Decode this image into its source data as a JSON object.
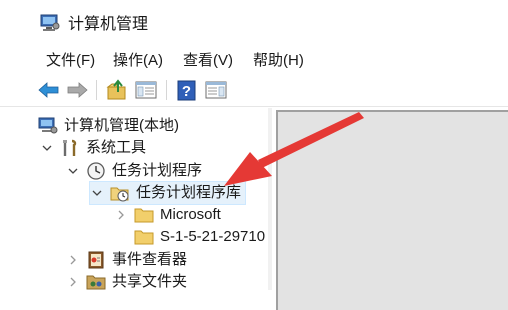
{
  "window": {
    "title": "计算机管理",
    "icon": "computer-management-icon"
  },
  "menu": [
    {
      "label": "文件(F)"
    },
    {
      "label": "操作(A)"
    },
    {
      "label": "查看(V)"
    },
    {
      "label": "帮助(H)"
    }
  ],
  "toolbar": {
    "buttons": [
      "back-arrow-icon",
      "forward-arrow-icon",
      "up-folder-icon",
      "show-hide-tree-icon",
      "help-icon",
      "action-pane-icon"
    ]
  },
  "tree": {
    "root": {
      "label": "计算机管理(本地)",
      "icon": "computer-management-icon"
    },
    "system_tools": {
      "label": "系统工具",
      "icon": "tools-icon",
      "expanded": true
    },
    "task_scheduler": {
      "label": "任务计划程序",
      "icon": "clock-icon",
      "expanded": true
    },
    "task_library": {
      "label": "任务计划程序库",
      "icon": "folder-clock-icon",
      "expanded": true,
      "selected": true
    },
    "microsoft": {
      "label": "Microsoft",
      "icon": "folder-icon",
      "expanded": false
    },
    "sid_folder": {
      "label": "S-1-5-21-29710",
      "icon": "folder-icon"
    },
    "event_viewer": {
      "label": "事件查看器",
      "icon": "event-viewer-icon",
      "expanded": false
    },
    "shared_folders": {
      "label": "共享文件夹",
      "icon": "shared-folder-icon",
      "expanded": false
    }
  },
  "colors": {
    "selection": "#e5f1fb",
    "arrow": "#e53935",
    "pane": "#e3e3e3"
  }
}
